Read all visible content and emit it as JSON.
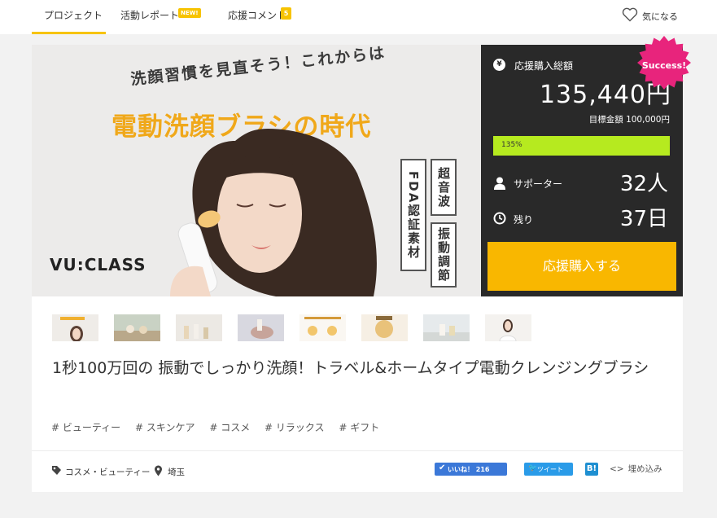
{
  "nav": {
    "tabs": [
      {
        "label": "プロジェクト",
        "active": true
      },
      {
        "label": "活動レポート",
        "badge": "NEW!"
      },
      {
        "label": "応援コメント",
        "badge": "5"
      }
    ],
    "favorite_label": "気になる"
  },
  "hero": {
    "headline": "洗顔習慣を見直そう！これからは",
    "big_text": "電動洗顔ブラシの時代",
    "brand": "VU:CLASS",
    "box1": "FDA認証素材",
    "box2": "超音波",
    "box3": "振動調節"
  },
  "stats": {
    "total_label": "応援購入総額",
    "total_amount": "135,440円",
    "goal": "目標金額 100,000円",
    "progress_text": "135%",
    "progress_fraction": 1.0,
    "supporters_label": "サポーター",
    "supporters_value": "32人",
    "remaining_label": "残り",
    "remaining_value": "37日",
    "success_badge": "Success!",
    "buy_button": "応援購入する"
  },
  "title": "1秒100万回の 振動でしっかり洗顔！トラベル&ホームタイプ電動クレンジングブラシ",
  "tags": [
    "# ビューティー",
    "# スキンケア",
    "# コスメ",
    "# リラックス",
    "# ギフト"
  ],
  "meta": {
    "category": "コスメ・ビューティー",
    "location": "埼玉"
  },
  "share": {
    "like_label": "いいね！ 216",
    "tweet_label": "ツイート",
    "hatena_label": "B!",
    "embed_code": "<>",
    "embed_label": "埋め込み"
  },
  "colors": {
    "accent": "#f7c300",
    "buy_button": "#f9b700",
    "progress": "#b6ea1f",
    "panel": "#292929",
    "success_badge": "#e8247c"
  }
}
